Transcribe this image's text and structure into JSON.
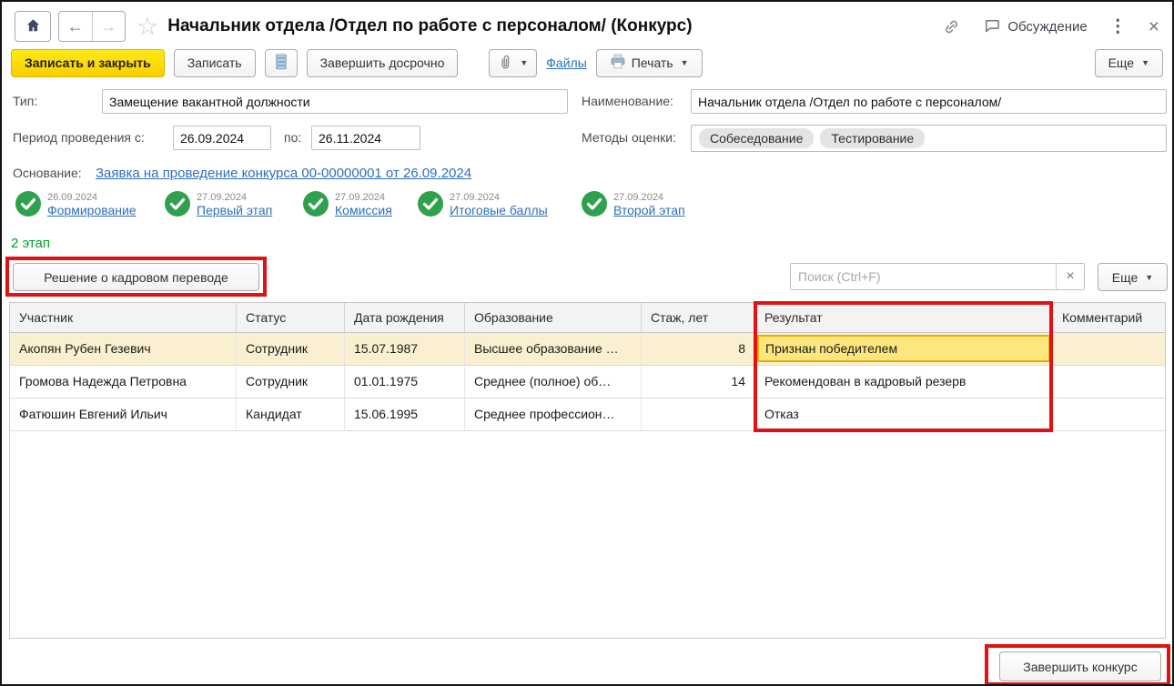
{
  "window": {
    "title": "Начальник отдела /Отдел по работе с персоналом/ (Конкурс)",
    "discussion_label": "Обсуждение"
  },
  "icons": {
    "back": "←",
    "forward": "→",
    "star": "☆",
    "kebab": "⋮",
    "close": "×",
    "dropdown": "▼",
    "clear": "×"
  },
  "toolbar": {
    "save_close_label": "Записать и закрыть",
    "save_label": "Записать",
    "finish_early_label": "Завершить досрочно",
    "files_label": "Файлы",
    "print_label": "Печать",
    "more_label": "Еще"
  },
  "form": {
    "type_label": "Тип:",
    "type_value": "Замещение вакантной должности",
    "name_label": "Наименование:",
    "name_value": "Начальник отдела /Отдел по работе с персоналом/",
    "period_label": "Период проведения с:",
    "period_from": "26.09.2024",
    "period_to_label": "по:",
    "period_to": "26.11.2024",
    "methods_label": "Методы оценки:",
    "methods": [
      "Собеседование",
      "Тестирование"
    ],
    "basis_label": "Основание:",
    "basis_link": "Заявка на проведение конкурса 00-00000001 от 26.09.2024"
  },
  "stages": [
    {
      "date": "26.09.2024",
      "label": "Формирование"
    },
    {
      "date": "27.09.2024",
      "label": "Первый этап"
    },
    {
      "date": "27.09.2024",
      "label": "Комиссия"
    },
    {
      "date": "27.09.2024",
      "label": "Итоговые баллы"
    },
    {
      "date": "27.09.2024",
      "label": "Второй этап"
    }
  ],
  "stage_section": {
    "title": "2 этап",
    "decision_button_label": "Решение о кадровом переводе",
    "search_placeholder": "Поиск (Ctrl+F)",
    "more_label": "Еще"
  },
  "table": {
    "headers": [
      "Участник",
      "Статус",
      "Дата рождения",
      "Образование",
      "Стаж, лет",
      "Результат",
      "Комментарий"
    ],
    "rows": [
      {
        "participant": "Акопян Рубен Гезевич",
        "status": "Сотрудник",
        "birth": "15.07.1987",
        "education": "Высшее образование …",
        "experience": "8",
        "result": "Признан победителем",
        "comment": ""
      },
      {
        "participant": "Громова Надежда Петровна",
        "status": "Сотрудник",
        "birth": "01.01.1975",
        "education": "Среднее (полное) об…",
        "experience": "14",
        "result": "Рекомендован в кадровый резерв",
        "comment": ""
      },
      {
        "participant": "Фатюшин Евгений Ильич",
        "status": "Кандидат",
        "birth": "15.06.1995",
        "education": "Среднее профессион…",
        "experience": "",
        "result": "Отказ",
        "comment": ""
      }
    ]
  },
  "footer": {
    "finish_button_label": "Завершить конкурс"
  },
  "colors": {
    "accent_yellow": "#FBD800",
    "annotation_red": "#E01212",
    "stage_green": "#2FA14D",
    "section_green": "#00A326",
    "link_blue": "#2E6FB8",
    "selected_row": "#FAF0D0",
    "winner_cell_bg": "#FBE77E",
    "winner_cell_border": "#E5AE00"
  }
}
